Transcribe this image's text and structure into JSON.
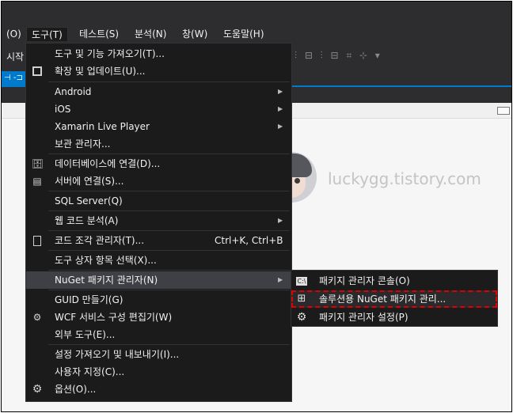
{
  "menubar": {
    "items": [
      {
        "label": "(O)"
      },
      {
        "label": "도구(T)"
      },
      {
        "label": "테스트(S)"
      },
      {
        "label": "분석(N)"
      },
      {
        "label": "창(W)"
      },
      {
        "label": "도움말(H)"
      }
    ]
  },
  "toolbar": {
    "start_label": "시작",
    "icons_text": "⫶ ⊟  ⫶ ⊟   ⌗ ⊹ ▾"
  },
  "tabstrip": {
    "pin_label": "⊣ -⊐"
  },
  "tools_menu": {
    "items": [
      {
        "label": "도구 및 기능 가져오기(T)...",
        "icon": ""
      },
      {
        "label": "확장 및 업데이트(U)...",
        "icon": "extensions-icon"
      },
      {
        "label": "Android",
        "arrow": "▶"
      },
      {
        "label": "iOS",
        "arrow": "▶"
      },
      {
        "label": "Xamarin Live Player",
        "arrow": "▶"
      },
      {
        "label": "보관 관리자..."
      },
      {
        "label": "데이터베이스에 연결(D)...",
        "icon": "database-connect-icon"
      },
      {
        "label": "서버에 연결(S)...",
        "icon": "server-connect-icon"
      },
      {
        "label": "SQL Server(Q)"
      },
      {
        "label": "웹 코드 분석(A)",
        "arrow": "▶"
      },
      {
        "label": "코드 조각 관리자(T)...",
        "shortcut": "Ctrl+K, Ctrl+B",
        "icon": "snippet-icon"
      },
      {
        "label": "도구 상자 항목 선택(X)..."
      },
      {
        "label": "NuGet 패키지 관리자(N)",
        "arrow": "▶"
      },
      {
        "label": "GUID 만들기(G)"
      },
      {
        "label": "WCF 서비스 구성 편집기(W)",
        "icon": "wcf-gear-icon"
      },
      {
        "label": "외부 도구(E)..."
      },
      {
        "label": "설정 가져오기 및 내보내기(I)..."
      },
      {
        "label": "사용자 지정(C)..."
      },
      {
        "label": "옵션(O)...",
        "icon": "gear-icon"
      }
    ]
  },
  "nuget_submenu": {
    "items": [
      {
        "label": "패키지 관리자 콘솔(O)",
        "icon": "console-icon",
        "icon_text": "C:\\"
      },
      {
        "label": "솔루션용 NuGet 패키지 관리...",
        "icon": "nuget-package-icon",
        "icon_text": "⊞"
      },
      {
        "label": "패키지 관리자 설정(P)",
        "icon": "gear-icon",
        "icon_text": "⚙"
      }
    ]
  },
  "watermark": {
    "text": "luckygg.tistory.com"
  },
  "colors": {
    "accent": "#007acc",
    "menu_bg": "#1b1b1c",
    "highlight_border": "#e00000"
  }
}
